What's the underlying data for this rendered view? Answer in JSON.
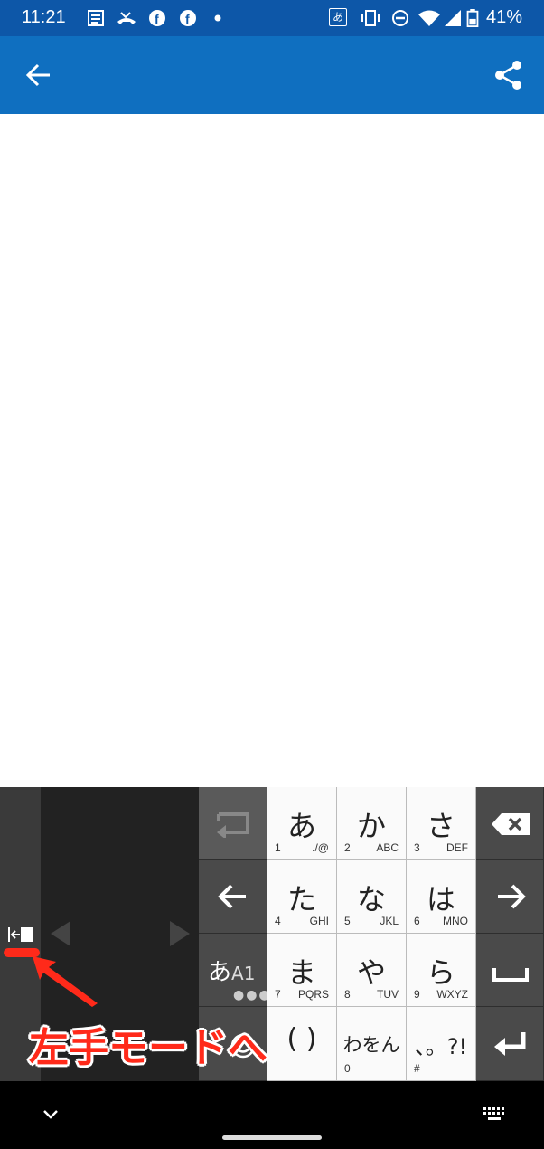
{
  "status_bar": {
    "time": "11:21",
    "battery": "41%",
    "ime_indicator": "あ",
    "icons": [
      "news-icon",
      "missed-call-icon",
      "facebook-icon",
      "facebook-icon",
      "dot-icon",
      "vibrate-icon",
      "dnd-icon",
      "wifi-icon",
      "signal-icon",
      "battery-icon"
    ]
  },
  "app_bar": {
    "background": "#0f6fc0"
  },
  "keyboard": {
    "keys": {
      "a": {
        "main": "あ",
        "num": "1",
        "sub": "./@"
      },
      "ka": {
        "main": "か",
        "num": "2",
        "sub": "ABC"
      },
      "sa": {
        "main": "さ",
        "num": "3",
        "sub": "DEF"
      },
      "ta": {
        "main": "た",
        "num": "4",
        "sub": "GHI"
      },
      "na": {
        "main": "な",
        "num": "5",
        "sub": "JKL"
      },
      "ha": {
        "main": "は",
        "num": "6",
        "sub": "MNO"
      },
      "ma": {
        "main": "ま",
        "num": "7",
        "sub": "PQRS"
      },
      "ya": {
        "main": "や",
        "num": "8",
        "sub": "TUV"
      },
      "ra": {
        "main": "ら",
        "num": "9",
        "sub": "WXYZ"
      },
      "paren": {
        "main": "( )"
      },
      "wa": {
        "main": "わをん",
        "num": "0"
      },
      "punct": {
        "main": "、。?!",
        "num": "#"
      }
    },
    "mode_key": {
      "label_main": "あ",
      "label_sub": "A1",
      "dots": "●●●"
    }
  },
  "annotation": {
    "text": "左手モードへ",
    "color": "#ff2a1a"
  }
}
